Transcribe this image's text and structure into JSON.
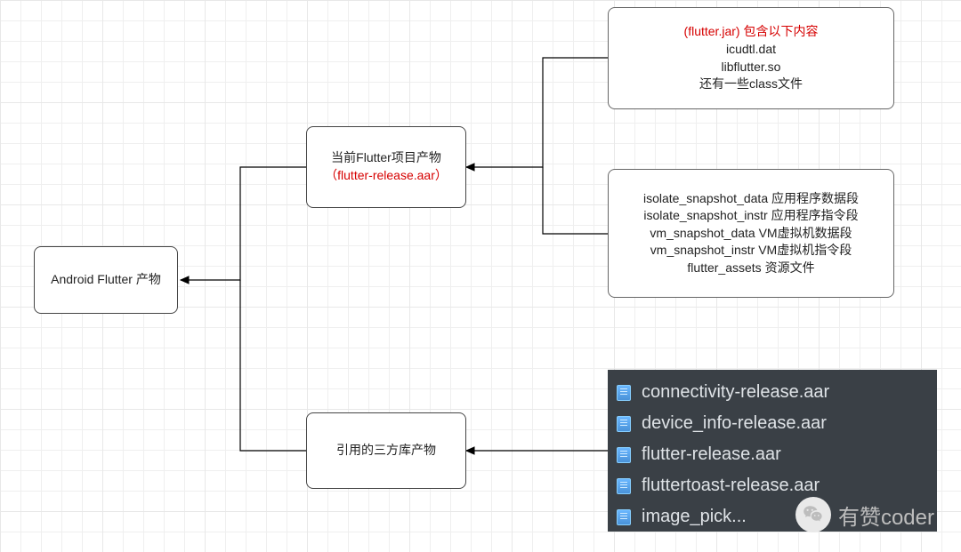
{
  "diagram": {
    "root": {
      "label": "Android Flutter 产物"
    },
    "flutterProject": {
      "line1": "当前Flutter项目产物",
      "line2": "（flutter-release.aar）"
    },
    "thirdParty": {
      "label": "引用的三方库产物"
    },
    "flutterJar": {
      "line1": "(flutter.jar) 包含以下内容",
      "line2": "icudtl.dat",
      "line3": "libflutter.so",
      "line4": "还有一些class文件"
    },
    "snapshot": {
      "line1": "isolate_snapshot_data 应用程序数据段",
      "line2": "isolate_snapshot_instr 应用程序指令段",
      "line3": "vm_snapshot_data VM虚拟机数据段",
      "line4": "vm_snapshot_instr VM虚拟机指令段",
      "line5": "flutter_assets 资源文件"
    }
  },
  "filePanel": {
    "items": [
      "connectivity-release.aar",
      "device_info-release.aar",
      "flutter-release.aar",
      "fluttertoast-release.aar",
      "image_pick..."
    ]
  },
  "watermark": {
    "text": "有赞coder"
  }
}
